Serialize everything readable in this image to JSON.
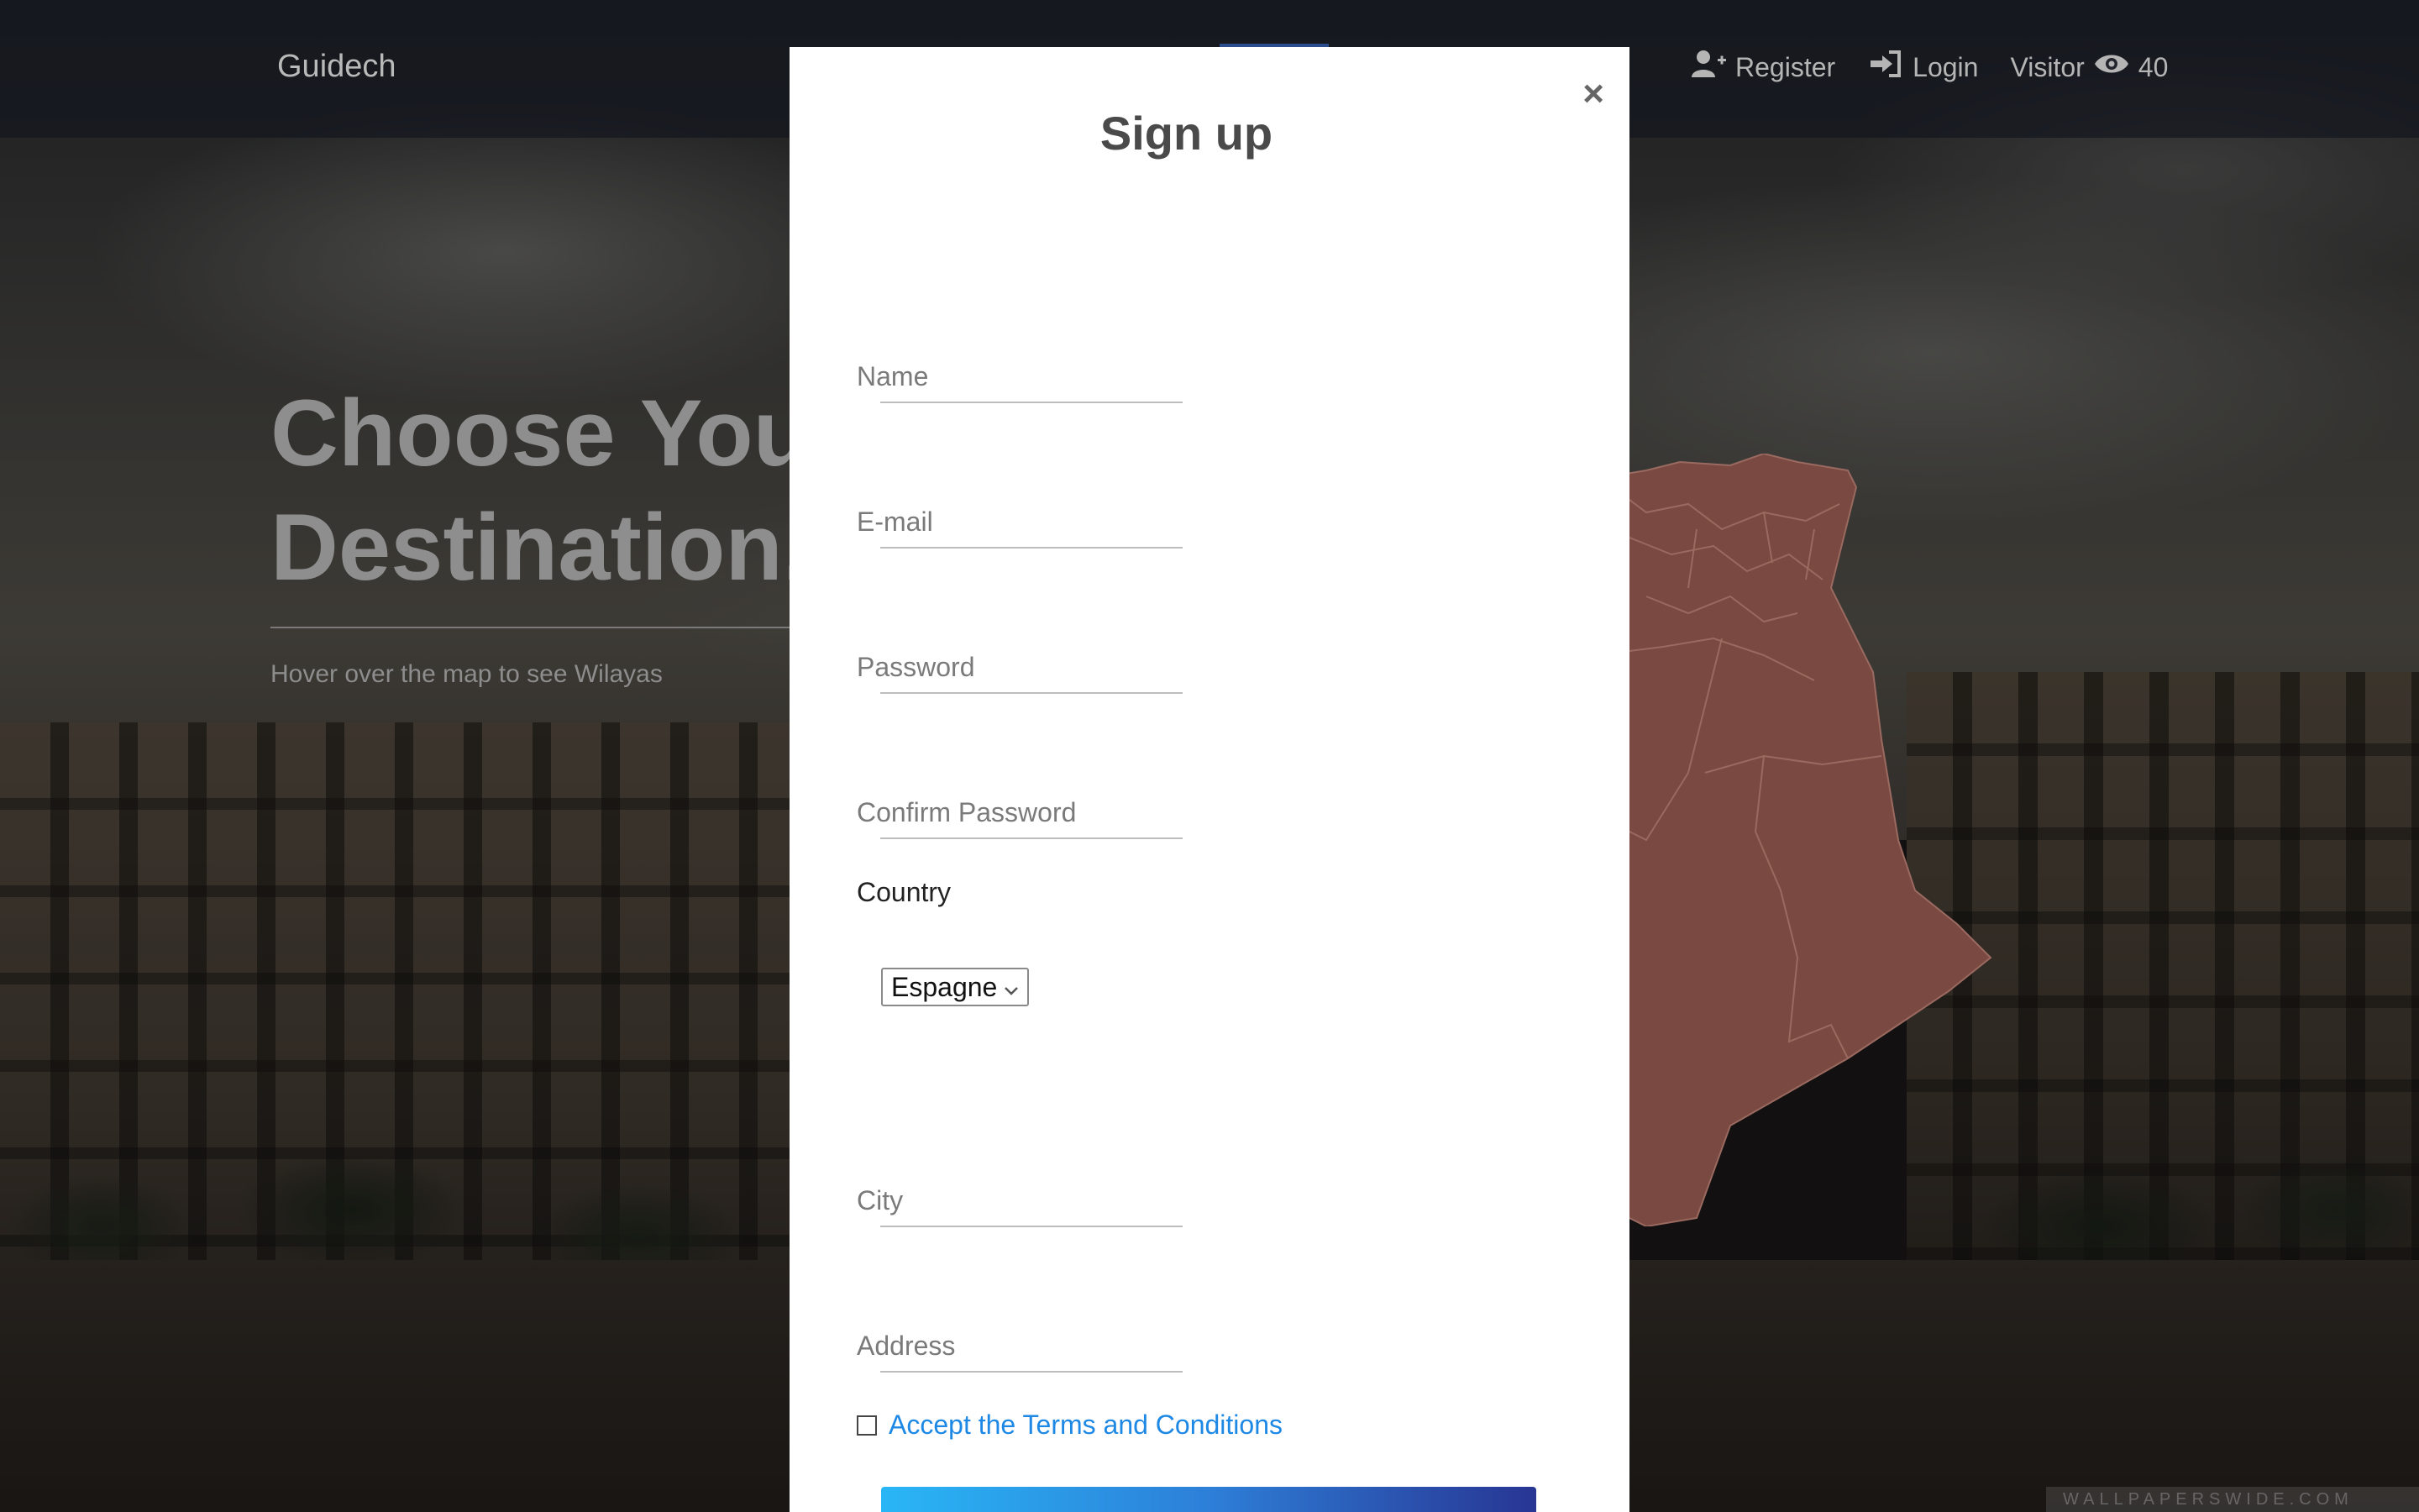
{
  "navbar": {
    "brand": "Guidech",
    "register_label": "Register",
    "login_label": "Login",
    "visitor_label": "Visitor",
    "visitor_count": "40"
  },
  "hero": {
    "title_line1": "Choose Your",
    "title_line2": "Destination..",
    "subtitle": "Hover over the map to see Wilayas"
  },
  "modal": {
    "close": "×",
    "title": "Sign up",
    "fields": {
      "name": "Name",
      "email": "E-mail",
      "password": "Password",
      "confirm_password": "Confirm Password",
      "city": "City",
      "address": "Address"
    },
    "country_label": "Country",
    "country_selected": "Espagne",
    "terms_label": "Accept the Terms and Conditions"
  },
  "colors": {
    "map_fill": "#7a4a42",
    "link_blue": "#1e88e5",
    "button_gradient_start": "#29b6f6",
    "button_gradient_end": "#283593"
  },
  "icons": [
    "user-plus-icon",
    "sign-in-icon",
    "eye-icon",
    "close-icon",
    "chevron-down-icon"
  ]
}
